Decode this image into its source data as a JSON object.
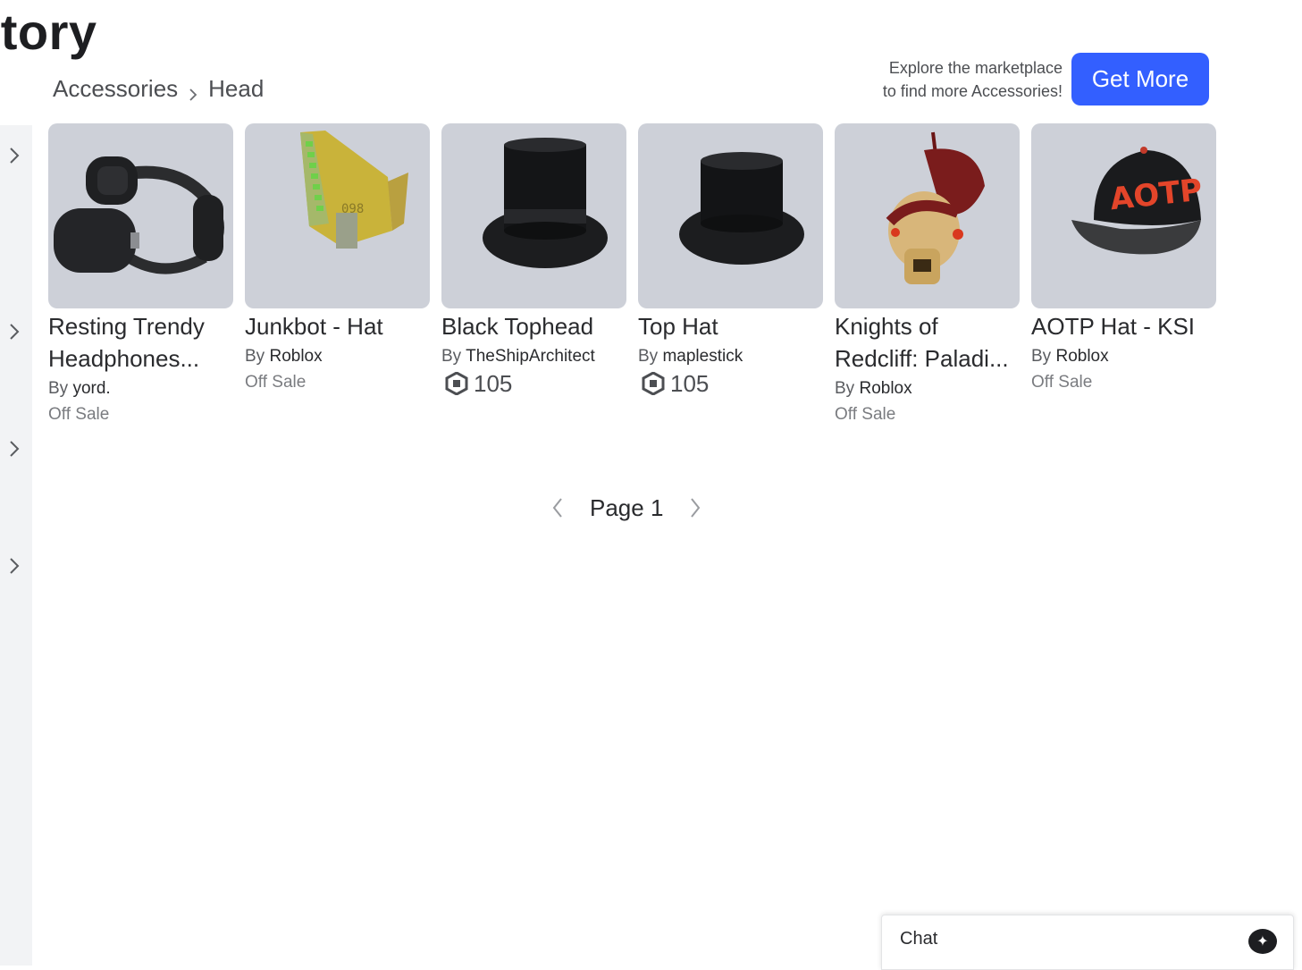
{
  "header": {
    "title": "ntory",
    "breadcrumb": [
      "Accessories",
      "Head"
    ]
  },
  "promo": {
    "line1": "Explore the marketplace",
    "line2": "to find more Accessories!",
    "button_label": "Get More"
  },
  "items": [
    {
      "name": "Resting Trendy Headphones...",
      "by": "By",
      "creator": "yord.",
      "status": "Off Sale",
      "price": null,
      "icon": "headphones-image"
    },
    {
      "name": "Junkbot - Hat",
      "by": "By",
      "creator": "Roblox",
      "status": "Off Sale",
      "price": null,
      "icon": "junkbot-hat-image"
    },
    {
      "name": "Black Tophead",
      "by": "By",
      "creator": "TheShipArchitect",
      "status": null,
      "price": "105",
      "icon": "black-top-hat-image"
    },
    {
      "name": "Top Hat",
      "by": "By",
      "creator": "maplestick",
      "status": null,
      "price": "105",
      "icon": "top-hat-image"
    },
    {
      "name": "Knights of Redcliff: Paladi...",
      "by": "By",
      "creator": "Roblox",
      "status": "Off Sale",
      "price": null,
      "icon": "paladin-helmet-image"
    },
    {
      "name": "AOTP Hat - KSI",
      "by": "By",
      "creator": "Roblox",
      "status": "Off Sale",
      "price": null,
      "icon": "aotp-cap-image"
    }
  ],
  "pager": {
    "label": "Page 1"
  },
  "chat": {
    "label": "Chat"
  },
  "colors": {
    "accent": "#335fff",
    "thumb_bg": "#cdd0d8",
    "rail_bg": "#f2f3f5"
  }
}
